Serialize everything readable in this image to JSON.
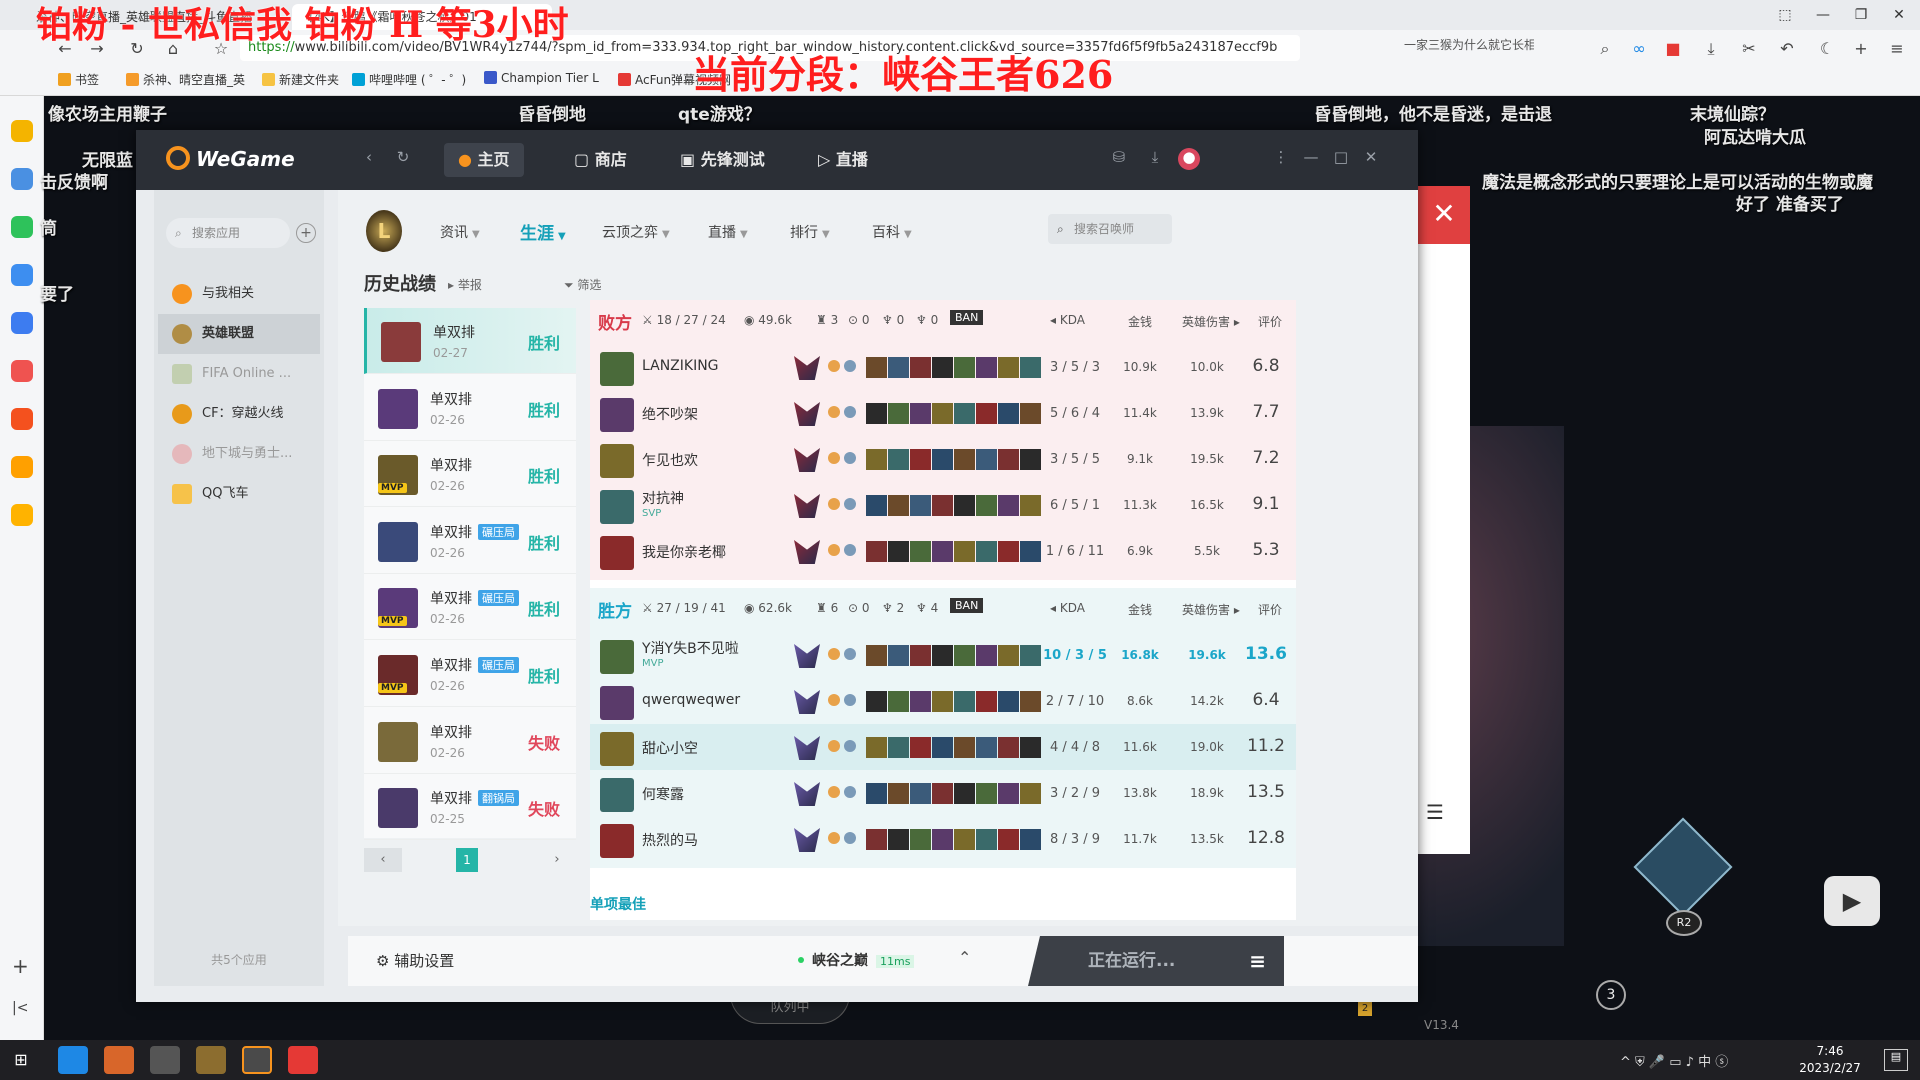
{
  "browser": {
    "tabs": [
      "杀神、晴空直播_英雄联盟直播_斗鱼直播",
      "【4K】企鹅《霜叶秋苍之秋》01"
    ],
    "url_scheme": "https://",
    "url_rest": "www.bilibili.com/video/BV1WR4y1z744/?spm_id_from=333.934.top_right_bar_window_history.content.click&vd_source=3357fd6f5f9fb5a243187eccf9b",
    "right_hint": "一家三猴为什么就它长相好",
    "bookmarks": [
      "书签",
      "杀神、晴空直播_英",
      "新建文件夹",
      "哔哩哔哩 ( ゜- ゜)",
      "Champion Tier L",
      "AcFun弹幕视频网"
    ],
    "overlay_top": "铂粉 - 世私信我 铂粉 H 等3小时",
    "overlay_rank": "当前分段：峡谷王者626"
  },
  "danmaku": [
    "像农场主用鞭子",
    "昏昏倒地",
    "qte游戏？",
    "昏昏倒地，他不是昏迷，是击退",
    "末境仙踪？",
    "阿瓦达啃大瓜",
    "无限蓝",
    "击反馈啊",
    "魔法是概念形式的只要理论上是可以活动的生物或魔",
    "好了 准备买了",
    "要了",
    "筒"
  ],
  "wegame": {
    "brand": "WeGame",
    "nav": [
      "主页",
      "商店",
      "先锋测试",
      "直播"
    ],
    "sidebar": {
      "search_placeholder": "搜索应用",
      "items": [
        "与我相关",
        "英雄联盟",
        "FIFA Online ...",
        "CF：穿越火线",
        "地下城与勇士...",
        "QQ飞车"
      ],
      "footer": "共5个应用"
    },
    "lol_nav": [
      "资讯",
      "生涯",
      "云顶之弈",
      "直播",
      "排行",
      "百科"
    ],
    "lol_search_placeholder": "搜索召唤师",
    "history": {
      "title": "历史战绩",
      "sub": "举报",
      "filter": "筛选",
      "matches": [
        {
          "mode": "单双排",
          "tag": "",
          "date": "02-27",
          "result": "胜利",
          "mvp": ""
        },
        {
          "mode": "单双排",
          "tag": "",
          "date": "02-26",
          "result": "胜利",
          "mvp": ""
        },
        {
          "mode": "单双排",
          "tag": "",
          "date": "02-26",
          "result": "胜利",
          "mvp": "MVP"
        },
        {
          "mode": "单双排",
          "tag": "碾压局",
          "date": "02-26",
          "result": "胜利",
          "mvp": ""
        },
        {
          "mode": "单双排",
          "tag": "碾压局",
          "date": "02-26",
          "result": "胜利",
          "mvp": "MVP"
        },
        {
          "mode": "单双排",
          "tag": "碾压局",
          "date": "02-26",
          "result": "胜利",
          "mvp": "MVP"
        },
        {
          "mode": "单双排",
          "tag": "",
          "date": "02-26",
          "result": "失败",
          "mvp": ""
        },
        {
          "mode": "单双排",
          "tag": "翻锅局",
          "date": "02-25",
          "result": "失败",
          "mvp": ""
        }
      ],
      "page": "1"
    },
    "board": {
      "col_kda": "KDA",
      "col_gold": "金钱",
      "col_dmg": "英雄伤害",
      "col_score": "评价",
      "ban": "BAN",
      "lose": {
        "name": "败方",
        "kda": "18 / 27 / 24",
        "gold": "49.6k",
        "towers": "3",
        "barons": "0",
        "dragons": "0",
        "heralds": "0",
        "players": [
          {
            "name": "LANZIKING",
            "kda": "3 / 5 / 3",
            "gold": "10.9k",
            "dmg": "10.0k",
            "score": "6.8",
            "badge": ""
          },
          {
            "name": "绝不吵架",
            "kda": "5 / 6 / 4",
            "gold": "11.4k",
            "dmg": "13.9k",
            "score": "7.7",
            "badge": ""
          },
          {
            "name": "乍见也欢",
            "kda": "3 / 5 / 5",
            "gold": "9.1k",
            "dmg": "19.5k",
            "score": "7.2",
            "badge": ""
          },
          {
            "name": "对抗神",
            "kda": "6 / 5 / 1",
            "gold": "11.3k",
            "dmg": "16.5k",
            "score": "9.1",
            "badge": "SVP"
          },
          {
            "name": "我是你亲老椰",
            "kda": "1 / 6 / 11",
            "gold": "6.9k",
            "dmg": "5.5k",
            "score": "5.3",
            "badge": ""
          }
        ]
      },
      "win": {
        "name": "胜方",
        "kda": "27 / 19 / 41",
        "gold": "62.6k",
        "towers": "6",
        "barons": "0",
        "dragons": "2",
        "heralds": "4",
        "players": [
          {
            "name": "Y消Y失B不见啦",
            "kda": "10 / 3 / 5",
            "gold": "16.8k",
            "dmg": "19.6k",
            "score": "13.6",
            "badge": "MVP"
          },
          {
            "name": "qwerqweqwer",
            "kda": "2 / 7 / 10",
            "gold": "8.6k",
            "dmg": "14.2k",
            "score": "6.4",
            "badge": ""
          },
          {
            "name": "甜心小空",
            "kda": "4 / 4 / 8",
            "gold": "11.6k",
            "dmg": "19.0k",
            "score": "11.2",
            "badge": ""
          },
          {
            "name": "何寒露",
            "kda": "3 / 2 / 9",
            "gold": "13.8k",
            "dmg": "18.9k",
            "score": "13.5",
            "badge": ""
          },
          {
            "name": "热烈的马",
            "kda": "8 / 3 / 9",
            "gold": "11.7k",
            "dmg": "13.5k",
            "score": "12.8",
            "badge": ""
          }
        ]
      },
      "section": "单项最佳"
    },
    "bottom": {
      "aux": "辅助设置",
      "server": "峡谷之巅",
      "ping": "11ms",
      "running": "正在运行..."
    }
  },
  "game_hud": {
    "queue": "队列中",
    "version": "V13.4",
    "r2": "R2",
    "count": "3",
    "chat_badge": "2"
  },
  "taskbar": {
    "time": "7:46",
    "date": "2023/2/27",
    "ime": "中"
  }
}
